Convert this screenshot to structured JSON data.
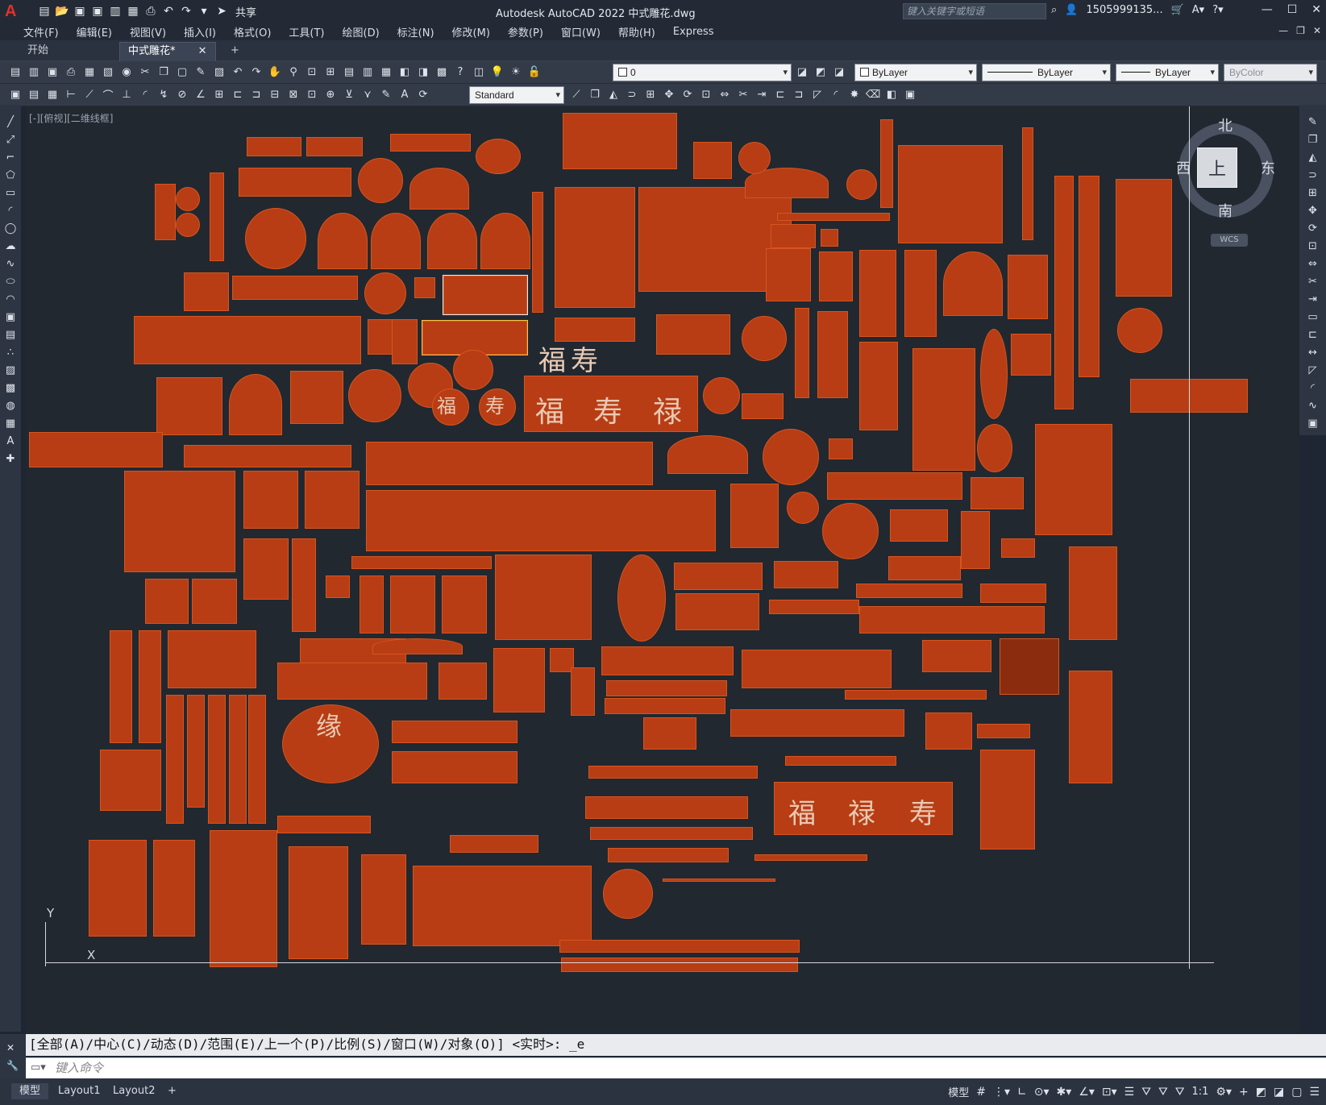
{
  "app": {
    "title": "Autodesk AutoCAD 2022    中式雕花.dwg",
    "logo": "A",
    "share_label": "共享",
    "search_placeholder": "键入关键字或短语",
    "user": "1505999135...",
    "window_controls": [
      "—",
      "☐",
      "✕"
    ]
  },
  "menu": {
    "items": [
      "文件(F)",
      "编辑(E)",
      "视图(V)",
      "插入(I)",
      "格式(O)",
      "工具(T)",
      "绘图(D)",
      "标注(N)",
      "修改(M)",
      "参数(P)",
      "窗口(W)",
      "帮助(H)",
      "Express"
    ],
    "right_controls": [
      "—",
      "❐",
      "✕"
    ]
  },
  "tabs": {
    "start": "开始",
    "active": "中式雕花*",
    "close": "✕",
    "add": "+"
  },
  "toolbar1": {
    "layer_value": "0",
    "color_value": "ByLayer",
    "linetype_value": "ByLayer",
    "lineweight_value": "ByLayer",
    "plotstyle_value": "ByColor"
  },
  "toolbar2": {
    "textstyle_value": "Standard"
  },
  "canvas": {
    "view_label": "[-][俯视][二维线框]",
    "art_text": [
      "福",
      "寿",
      "福",
      "寿",
      "禄",
      "福",
      "禄",
      "寿",
      "福",
      "寿",
      "缘"
    ]
  },
  "viewcube": {
    "north": "北",
    "south": "南",
    "east": "东",
    "west": "西",
    "face": "上",
    "wcs": "WCS"
  },
  "ucs": {
    "y": "Y",
    "x": "X"
  },
  "command": {
    "history": "[全部(A)/中心(C)/动态(D)/范围(E)/上一个(P)/比例(S)/窗口(W)/对象(O)] <实时>: _e",
    "placeholder": "键入命令"
  },
  "status": {
    "layout_tabs": [
      "模型",
      "Layout1",
      "Layout2"
    ],
    "add": "+",
    "model_label": "模型",
    "scale": "1:1"
  }
}
